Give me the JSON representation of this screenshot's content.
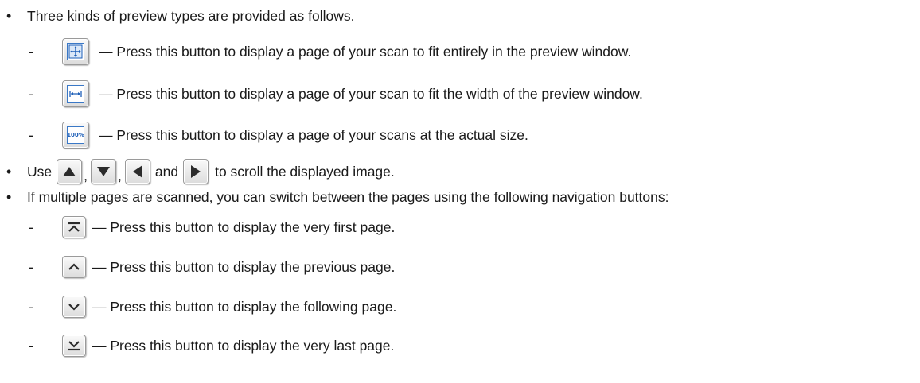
{
  "preview": {
    "intro": "Three kinds of preview types are provided as follows.",
    "items": [
      {
        "icon": "fit-page-icon",
        "text": "— Press this button to display a page of your scan to fit entirely in the preview window."
      },
      {
        "icon": "fit-width-icon",
        "text": "— Press this button to display a page of your scan to fit the width of the preview window."
      },
      {
        "icon": "actual-size-icon",
        "icon_label": "100%",
        "text": "— Press this button to display a page of your scans at the actual size."
      }
    ]
  },
  "scroll": {
    "use": "Use",
    "comma1": ",",
    "comma2": ",",
    "and": "and",
    "rest": "to scroll the displayed image."
  },
  "navigation": {
    "intro": "If multiple pages are scanned, you can switch between the pages using the following navigation buttons:",
    "items": [
      {
        "icon": "first-page-icon",
        "text": "— Press this button to display the very first page."
      },
      {
        "icon": "previous-page-icon",
        "text": "— Press this button to display the previous page."
      },
      {
        "icon": "next-page-icon",
        "text": "— Press this button to display the following page."
      },
      {
        "icon": "last-page-icon",
        "text": "— Press this button to display the very last page."
      }
    ]
  },
  "symbols": {
    "bullet": "•",
    "dash": "-"
  },
  "colors": {
    "icon_blue": "#1e5fb8",
    "arrow_dark": "#2b2b2b"
  }
}
